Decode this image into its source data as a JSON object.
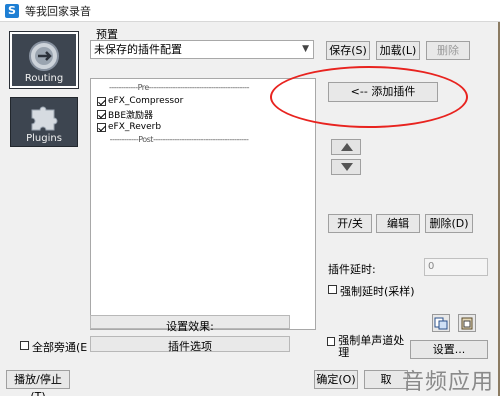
{
  "window": {
    "title": "等我回家录音",
    "app_icon": "S"
  },
  "nav": {
    "items": [
      {
        "label": "Routing",
        "icon": "routing-icon",
        "active": true
      },
      {
        "label": "Plugins",
        "icon": "puzzle-icon",
        "active": false
      }
    ]
  },
  "preset": {
    "label": "预置",
    "selected": "未保存的插件配置",
    "save_label": "保存(S)",
    "load_label": "加载(L)",
    "delete_label": "删除"
  },
  "plugin_list": {
    "pre_label": "------------Pre------------------------------------------",
    "post_label": "------------Post----------------------------------------",
    "items": [
      {
        "name": "eFX_Compressor",
        "checked": true
      },
      {
        "name": "BBE激励器",
        "checked": true
      },
      {
        "name": "eFX_Reverb",
        "checked": true
      }
    ]
  },
  "actions": {
    "add_plugin_label": "<-- 添加插件",
    "toggle_label": "开/关",
    "edit_label": "编辑",
    "delete_label": "删除(D)"
  },
  "latency": {
    "label": "插件延时:",
    "value": "0",
    "force_label": "强制延时(采样)"
  },
  "effects": {
    "settings_effect_label": "设置效果:",
    "plugin_options_label": "插件选项"
  },
  "options": {
    "bypass_all_label": "全部旁通(E",
    "force_mono_label": "强制单声道处理",
    "settings_label": "设置..."
  },
  "footer": {
    "play_stop_label": "播放/停止(T)",
    "ok_label": "确定(O)",
    "cancel_label": "取",
    "watermark": "音频应用"
  },
  "colors": {
    "highlight_ellipse": "#e8231f",
    "nav_bg": "#3d4550"
  }
}
